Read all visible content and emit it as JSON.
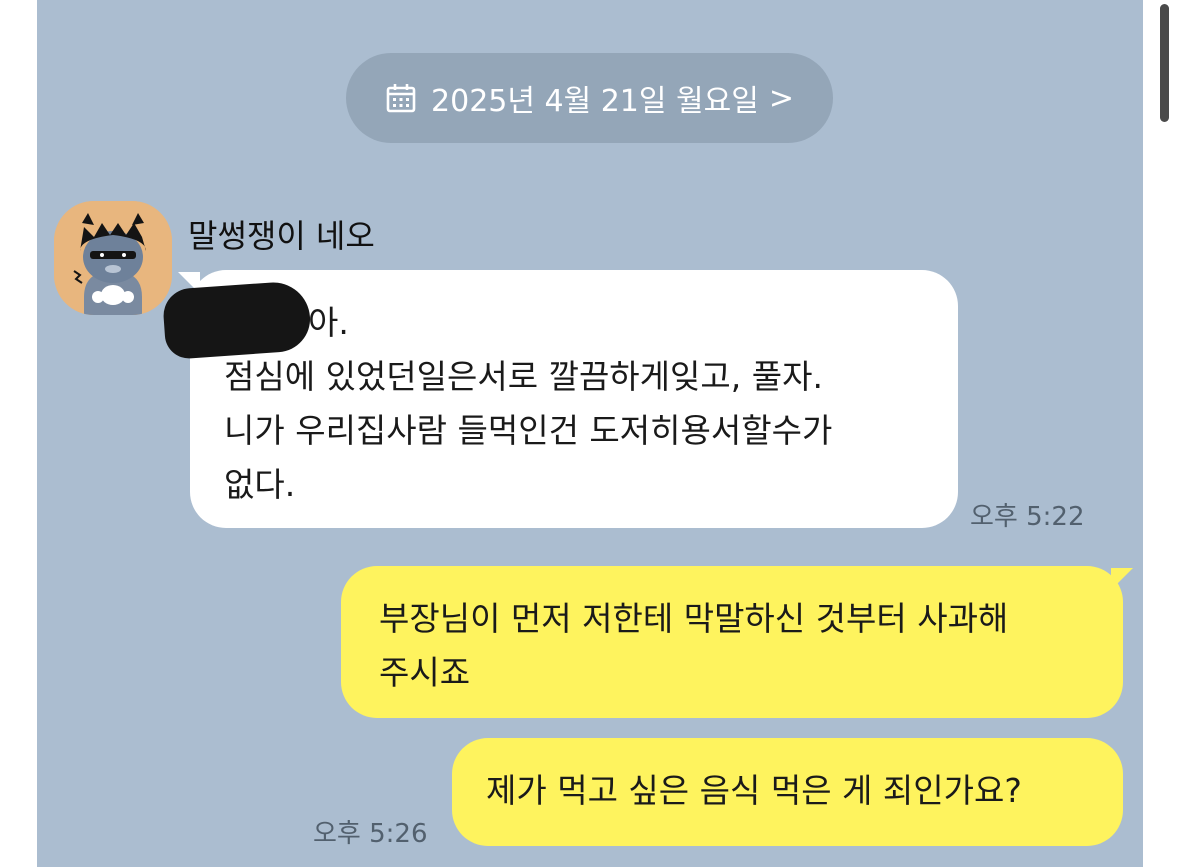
{
  "date_divider": {
    "label": "2025년 4월 21일 월요일",
    "icon": "calendar-icon",
    "chevron": ">"
  },
  "incoming": {
    "sender": "말썽쟁이 네오",
    "lines": [
      "아.",
      "점심에 있었던일은서로 깔끔하게잊고, 풀자.",
      "니가 우리집사람 들먹인건 도저히용서할수가",
      "없다."
    ],
    "time": "오후 5:22"
  },
  "outgoing": [
    {
      "lines": [
        "부장님이 먼저 저한테 막말하신 것부터 사과해",
        "주시죠"
      ]
    },
    {
      "lines": [
        "제가 먹고 싶은 음식 먹은 게 죄인가요?"
      ],
      "time": "오후 5:26"
    }
  ],
  "colors": {
    "chat_background": "#abbdd0",
    "outgoing_bubble": "#fef35e",
    "incoming_bubble": "#ffffff",
    "date_pill": "#94a6b8"
  }
}
